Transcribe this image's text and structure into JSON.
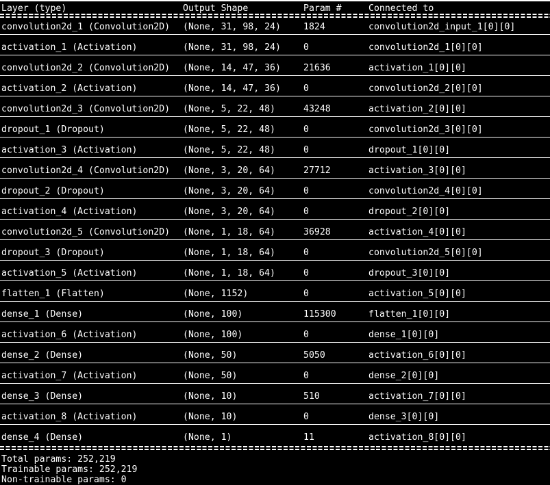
{
  "terminal": {
    "background_color": "#000000",
    "text_color": "#ffffff",
    "separator_char": "=",
    "header": {
      "layer": "Layer (type)",
      "output_shape": "Output Shape",
      "param": "Param #",
      "connected_to": "Connected to"
    },
    "rows": [
      {
        "layer": "convolution2d_1 (Convolution2D)",
        "output_shape": "(None, 31, 98, 24)",
        "param": "1824",
        "connected_to": "convolution2d_input_1[0][0]"
      },
      {
        "layer": "activation_1 (Activation)",
        "output_shape": "(None, 31, 98, 24)",
        "param": "0",
        "connected_to": "convolution2d_1[0][0]"
      },
      {
        "layer": "convolution2d_2 (Convolution2D)",
        "output_shape": "(None, 14, 47, 36)",
        "param": "21636",
        "connected_to": "activation_1[0][0]"
      },
      {
        "layer": "activation_2 (Activation)",
        "output_shape": "(None, 14, 47, 36)",
        "param": "0",
        "connected_to": "convolution2d_2[0][0]"
      },
      {
        "layer": "convolution2d_3 (Convolution2D)",
        "output_shape": "(None, 5, 22, 48)",
        "param": "43248",
        "connected_to": "activation_2[0][0]"
      },
      {
        "layer": "dropout_1 (Dropout)",
        "output_shape": "(None, 5, 22, 48)",
        "param": "0",
        "connected_to": "convolution2d_3[0][0]"
      },
      {
        "layer": "activation_3 (Activation)",
        "output_shape": "(None, 5, 22, 48)",
        "param": "0",
        "connected_to": "dropout_1[0][0]"
      },
      {
        "layer": "convolution2d_4 (Convolution2D)",
        "output_shape": "(None, 3, 20, 64)",
        "param": "27712",
        "connected_to": "activation_3[0][0]"
      },
      {
        "layer": "dropout_2 (Dropout)",
        "output_shape": "(None, 3, 20, 64)",
        "param": "0",
        "connected_to": "convolution2d_4[0][0]"
      },
      {
        "layer": "activation_4 (Activation)",
        "output_shape": "(None, 3, 20, 64)",
        "param": "0",
        "connected_to": "dropout_2[0][0]"
      },
      {
        "layer": "convolution2d_5 (Convolution2D)",
        "output_shape": "(None, 1, 18, 64)",
        "param": "36928",
        "connected_to": "activation_4[0][0]"
      },
      {
        "layer": "dropout_3 (Dropout)",
        "output_shape": "(None, 1, 18, 64)",
        "param": "0",
        "connected_to": "convolution2d_5[0][0]"
      },
      {
        "layer": "activation_5 (Activation)",
        "output_shape": "(None, 1, 18, 64)",
        "param": "0",
        "connected_to": "dropout_3[0][0]"
      },
      {
        "layer": "flatten_1 (Flatten)",
        "output_shape": "(None, 1152)",
        "param": "0",
        "connected_to": "activation_5[0][0]"
      },
      {
        "layer": "dense_1 (Dense)",
        "output_shape": "(None, 100)",
        "param": "115300",
        "connected_to": "flatten_1[0][0]"
      },
      {
        "layer": "activation_6 (Activation)",
        "output_shape": "(None, 100)",
        "param": "0",
        "connected_to": "dense_1[0][0]"
      },
      {
        "layer": "dense_2 (Dense)",
        "output_shape": "(None, 50)",
        "param": "5050",
        "connected_to": "activation_6[0][0]"
      },
      {
        "layer": "activation_7 (Activation)",
        "output_shape": "(None, 50)",
        "param": "0",
        "connected_to": "dense_2[0][0]"
      },
      {
        "layer": "dense_3 (Dense)",
        "output_shape": "(None, 10)",
        "param": "510",
        "connected_to": "activation_7[0][0]"
      },
      {
        "layer": "activation_8 (Activation)",
        "output_shape": "(None, 10)",
        "param": "0",
        "connected_to": "dense_3[0][0]"
      },
      {
        "layer": "dense_4 (Dense)",
        "output_shape": "(None, 1)",
        "param": "11",
        "connected_to": "activation_8[0][0]"
      }
    ],
    "footer": {
      "total_params": "Total params: 252,219",
      "trainable_params": "Trainable params: 252,219",
      "non_trainable_params": "Non-trainable params: 0"
    }
  }
}
